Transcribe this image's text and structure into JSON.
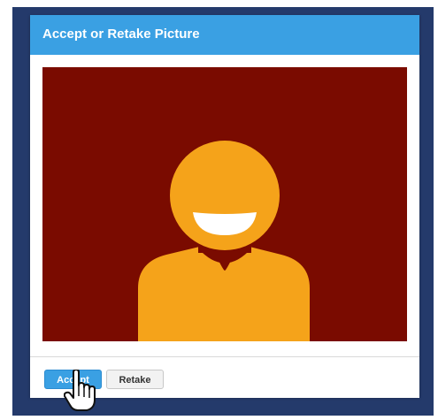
{
  "dialog": {
    "title": "Accept or Retake Picture"
  },
  "actions": {
    "accept_label": "Accept",
    "retake_label": "Retake"
  },
  "photo": {
    "subject": "avatar-placeholder-icon"
  },
  "cursor": {
    "icon": "hand-pointer-icon"
  },
  "colors": {
    "backdrop": "#243a6b",
    "titlebar": "#3aa0e3",
    "photo_background": "#7a0b00",
    "avatar": "#f5a31a",
    "accept_button": "#3aa0e3"
  }
}
